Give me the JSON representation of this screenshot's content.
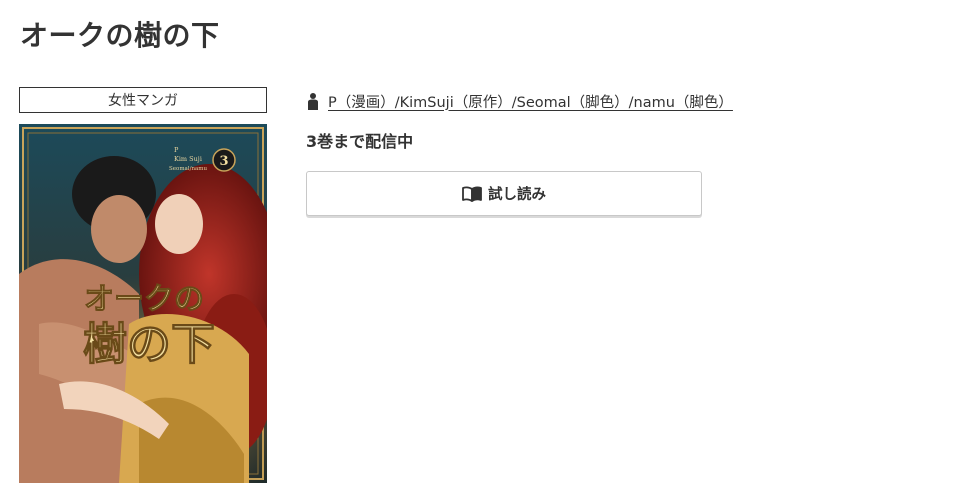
{
  "page": {
    "title": "オークの樹の下"
  },
  "genre": {
    "label": "女性マンガ"
  },
  "cover": {
    "alt": "オークの樹の下 3",
    "volume_badge": "3",
    "cover_title_line1": "オークの",
    "cover_title_line2": "樹の下",
    "credit_art": "P",
    "credit_story": "Kim Suji",
    "credit_adapt": "Seomal/namu"
  },
  "authors": {
    "icon": "person-icon",
    "text": "P（漫画）/KimSuji（原作）/Seomal（脚色）/namu（脚色）"
  },
  "status": {
    "text": "3巻まで配信中"
  },
  "trial": {
    "icon": "open-book-icon",
    "label": "試し読み"
  }
}
